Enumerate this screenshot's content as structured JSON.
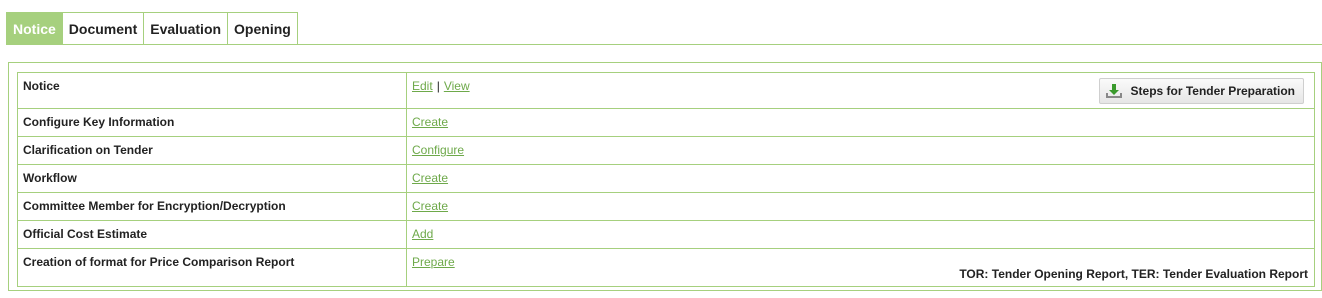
{
  "tabs": [
    "Notice",
    "Document",
    "Evaluation",
    "Opening"
  ],
  "active_tab": "Notice",
  "rows": [
    {
      "label": "Notice",
      "links": [
        "Edit",
        "View"
      ]
    },
    {
      "label": "Configure Key Information",
      "links": [
        "Create"
      ]
    },
    {
      "label": "Clarification on Tender",
      "links": [
        "Configure"
      ]
    },
    {
      "label": "Workflow",
      "links": [
        "Create"
      ]
    },
    {
      "label": "Committee Member for Encryption/Decryption",
      "links": [
        "Create"
      ]
    },
    {
      "label": "Official Cost Estimate",
      "links": [
        "Add"
      ]
    },
    {
      "label": "Creation of format for Price Comparison Report",
      "links": [
        "Prepare"
      ]
    }
  ],
  "steps_button": {
    "label": "Steps for Tender Preparation",
    "icon": "download-icon"
  },
  "footnote": "TOR: Tender Opening Report, TER: Tender Evaluation Report",
  "colors": {
    "accent": "#a6d07e",
    "link": "#6ea94a"
  }
}
